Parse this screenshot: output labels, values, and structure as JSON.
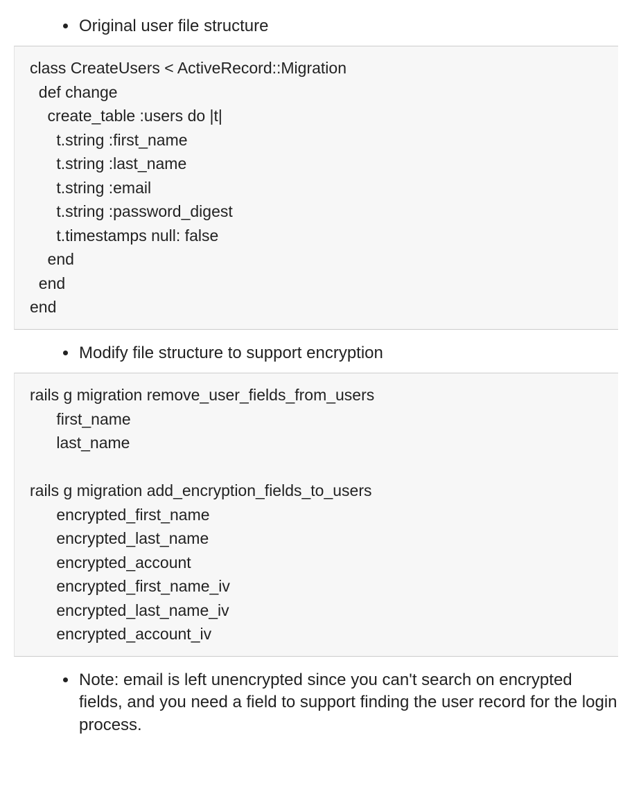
{
  "bullets": {
    "b1": "Original user file structure",
    "b2": "Modify file structure to support encryption",
    "b3": "Note: email is left unencrypted since you can't search on encrypted fields, and you need a field to support finding the user record for the login process."
  },
  "code": {
    "block1": "class CreateUsers < ActiveRecord::Migration\n  def change\n    create_table :users do |t|\n      t.string :first_name\n      t.string :last_name\n      t.string :email\n      t.string :password_digest\n      t.timestamps null: false\n    end\n  end\nend",
    "block2": "rails g migration remove_user_fields_from_users\n      first_name\n      last_name\n\nrails g migration add_encryption_fields_to_users\n      encrypted_first_name\n      encrypted_last_name\n      encrypted_account\n      encrypted_first_name_iv\n      encrypted_last_name_iv\n      encrypted_account_iv"
  }
}
